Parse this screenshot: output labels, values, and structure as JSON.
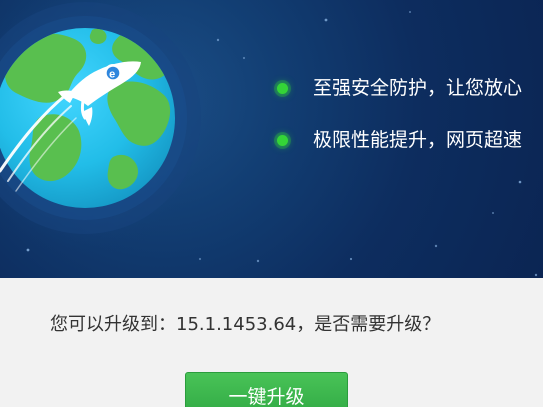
{
  "banner": {
    "features": [
      {
        "text": "至强安全防护，让您放心"
      },
      {
        "text": "极限性能提升，网页超速"
      }
    ],
    "colors": {
      "background": "#0d2d5f",
      "bullet": "#34d437",
      "ocean": "#23bde8",
      "land": "#59bf4f"
    },
    "icons": {
      "planet": "globe-icon",
      "rocket": "rocket-icon"
    }
  },
  "update": {
    "prompt": "您可以升级到：15.1.1453.64，是否需要升级？",
    "button_label": "一键升级",
    "button_color": "#34ad45"
  }
}
